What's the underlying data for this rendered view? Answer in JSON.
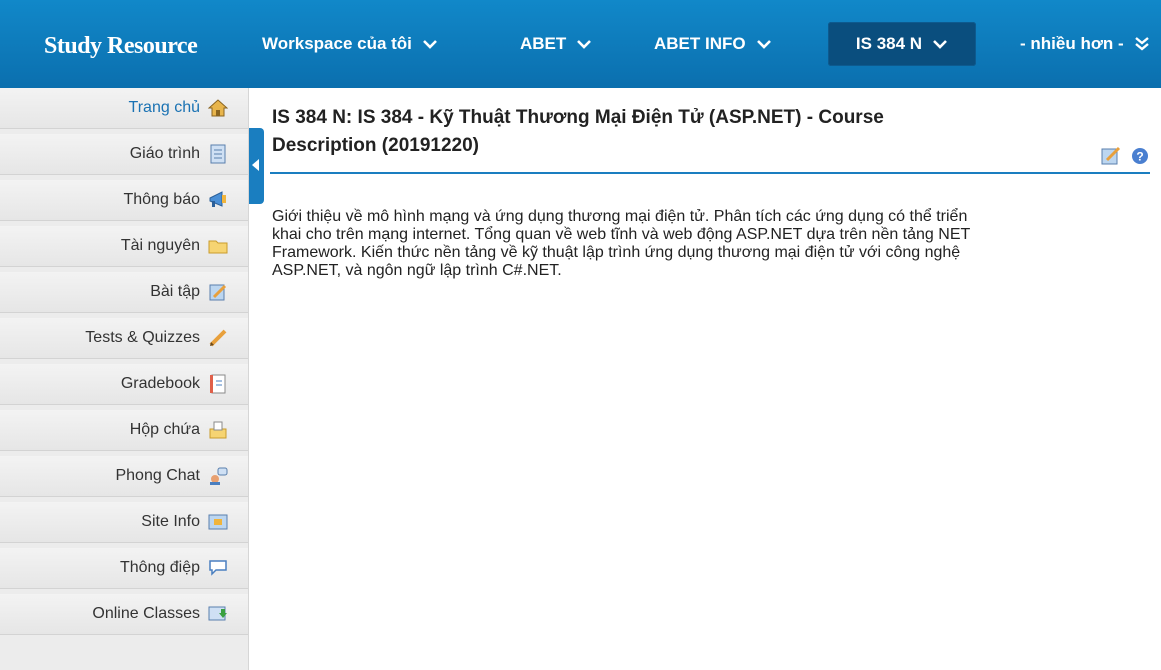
{
  "header": {
    "brand": "Study Resource",
    "nav": [
      {
        "label": "Workspace của tôi"
      },
      {
        "label": "ABET"
      },
      {
        "label": "ABET INFO"
      },
      {
        "label": "IS 384 N"
      },
      {
        "label": "- nhiều hơn -"
      }
    ]
  },
  "sidebar": {
    "items": [
      {
        "label": "Trang chủ",
        "icon": "home-icon"
      },
      {
        "label": "Giáo trình",
        "icon": "syllabus-icon"
      },
      {
        "label": "Thông báo",
        "icon": "announcement-icon"
      },
      {
        "label": "Tài nguyên",
        "icon": "folder-icon"
      },
      {
        "label": "Bài tập",
        "icon": "assignment-icon"
      },
      {
        "label": "Tests & Quizzes",
        "icon": "pencil-icon"
      },
      {
        "label": "Gradebook",
        "icon": "gradebook-icon"
      },
      {
        "label": "Hộp chứa",
        "icon": "dropbox-icon"
      },
      {
        "label": "Phong Chat",
        "icon": "chat-icon"
      },
      {
        "label": "Site Info",
        "icon": "site-info-icon"
      },
      {
        "label": "Thông điệp",
        "icon": "message-icon"
      },
      {
        "label": "Online Classes",
        "icon": "online-class-icon"
      }
    ]
  },
  "main": {
    "title_line1": "IS 384 N: IS 384 - Kỹ Thuật Thương Mại Điện Tử (ASP.NET) - Course",
    "title_line2": "Description (20191220)",
    "description": [
      "Giới thiệu về mô hình mạng và ứng dụng thương mại điện tử. Phân tích các ứng dụng có thể triển",
      "khai cho trên mạng internet. Tổng quan về web tĩnh và web động ASP.NET dựa trên nền tảng NET",
      "Framework. Kiến thức nền tảng về kỹ thuật lập trình ứng dụng thương mại điện tử với công nghệ",
      "ASP.NET, và ngôn ngữ lập trình C#.NET."
    ]
  },
  "colors": {
    "header_blue": "#0b6fae",
    "active_tab": "#0a4e7e",
    "accent": "#1a7ec0"
  }
}
